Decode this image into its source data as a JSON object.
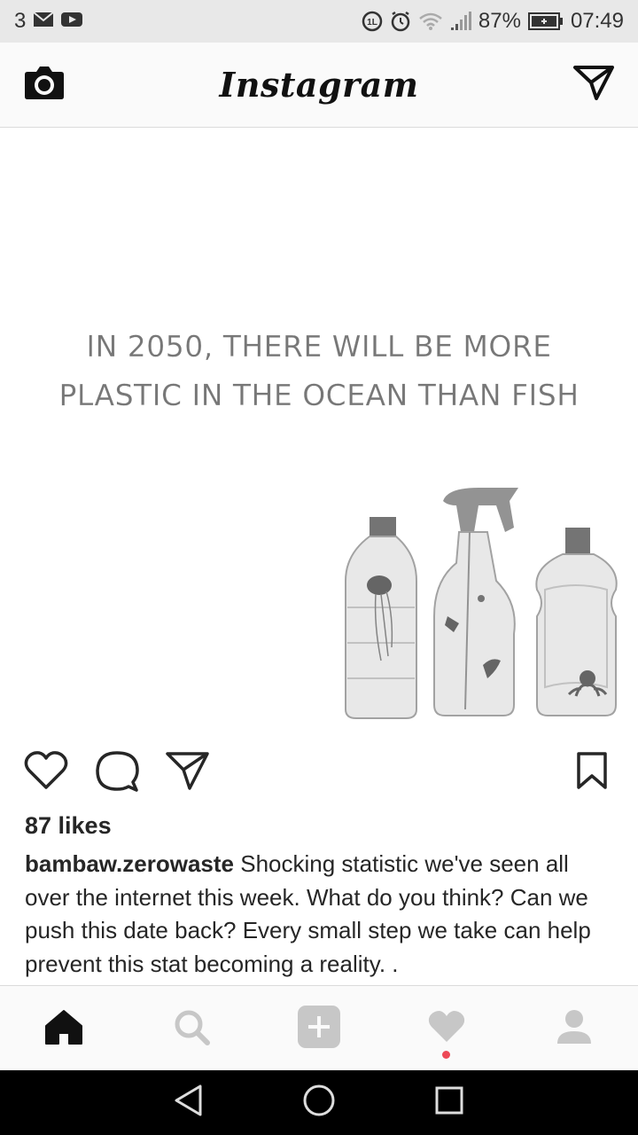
{
  "status_bar": {
    "notification_count": "3",
    "battery": "87%",
    "time": "07:49"
  },
  "header": {
    "logo": "Instagram"
  },
  "post": {
    "headline_line1": "IN 2050, THERE WILL BE MORE",
    "headline_line2": "PLASTIC IN THE OCEAN THAN FISH",
    "likes": "87 likes",
    "username": "bambaw.zerowaste",
    "caption": " Shocking statistic we've seen all over the internet this week. What do you think? Can we push this date back? Every small step we take can help prevent this stat becoming a reality. ."
  },
  "colors": {
    "notification_dot": "#ed4956",
    "nav_inactive": "#c7c7c7",
    "text": "#262626"
  }
}
